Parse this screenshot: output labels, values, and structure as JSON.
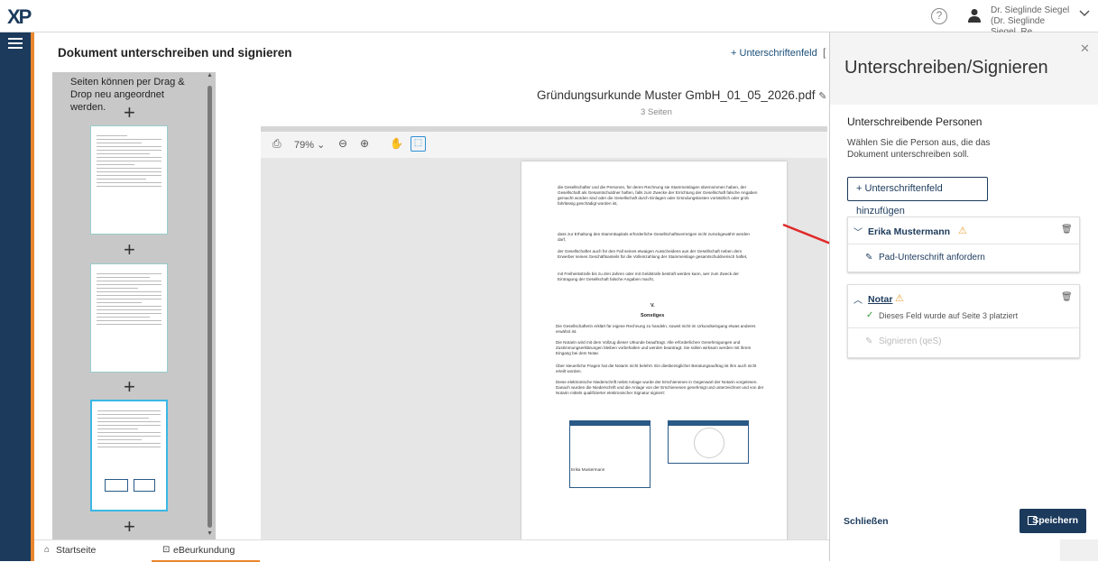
{
  "app": {
    "logo": "XP"
  },
  "header": {
    "user_line1": "Dr. Sieglinde Siegel",
    "user_line2": "(Dr. Sieglinde Siegel, Re..."
  },
  "main": {
    "title": "Dokument unterschreiben und signieren",
    "add_field_label": "Unterschriftenfeld",
    "thumbnail_hint": "Seiten können per Drag & Drop neu angeordnet werden.",
    "filename": "Gründungsurkunde Muster GmbH_01_05_2026.pdf",
    "page_count": "3 Seiten",
    "zoom": "79%"
  },
  "pdf": {
    "bullets": [
      "die Gesellschafter und die Personen, für deren Rechnung sie Stammeinlagen übernommen haben, der Gesellschaft als Gesamtschuldner haften, falls zum Zwecke der Errichtung der Gesellschaft falsche Angaben gemacht worden sind oder die Gesellschaft durch Einlagen oder Gründungskosten vorsätzlich oder grob fahrlässig geschädigt worden ist,",
      "dass zur Erhaltung des Stammkapitals erforderliche Gesellschaftsvermögen nicht zurückgewährt werden darf,",
      "der Gesellschafter auch für den Fall seines etwaigen Ausscheidens aus der Gesellschaft neben dem Erwerber seines Geschäftsanteils für die Volleinzahlung der Stammeinlage gesamtschuldnerisch haftet,",
      "mit Freiheitsstrafe bis zu drei Jahren oder mit Geldstrafe bestraft werden kann, wer zum Zweck der Eintragung der Gesellschaft falsche Angaben macht,"
    ],
    "section_number": "V.",
    "section_title": "Sonstiges",
    "paragraphs": [
      "Die Gesellschafterin erklärt für eigene Rechnung zu handeln, soweit nicht im Urkundseingang etwas anderes erwähnt ist.",
      "Die Notarin wird mit dem Vollzug dieser Urkunde beauftragt. Alle erforderlichen Genehmigungen und Zustimmungserklärungen bleiben vorbehalten und werden beantragt. Sie sollen wirksam werden mit ihrem Eingang bei dem Notar.",
      "Über steuerliche Fragen hat die Notarin nicht belehrt. Ein diesbezüglicher Beratungsauftrag ist ihm auch nicht erteilt worden.",
      "Diese elektronische Niederschrift nebst Anlage wurde der Erschienenen in Gegenwart der Notarin vorgelesen. Danach wurden die Niederschrift und die Anlage von der Erschienenen genehmigt und unterzeichnet und von der Notarin mittels qualifizierter elektronischer Signatur signiert:"
    ],
    "sig_box_label": "Erika Mustermann"
  },
  "panel": {
    "title": "Unterschreiben/Signieren",
    "section_title": "Unterschreibende Personen",
    "description": "Wählen Sie die Person aus, die das Dokument unterschreiben soll.",
    "add_button": "Unterschriftenfeld hinzufügen",
    "signer1": {
      "name": "Erika Mustermann",
      "action": "Pad-Unterschrift anfordern"
    },
    "signer2": {
      "name": "Notar",
      "status": "Dieses Feld wurde auf Seite 3 platziert",
      "action": "Signieren (qeS)"
    },
    "close_label": "Schließen",
    "save_label": "Speichern"
  },
  "bottom_tabs": [
    {
      "label": "Startseite"
    },
    {
      "label": "eBeurkundung"
    }
  ],
  "colors": {
    "navy": "#1b3a5c",
    "accent_orange": "#e9862d",
    "selection": "#3ab7e6",
    "warn": "#e9a43c",
    "success": "#3a9a3a"
  }
}
